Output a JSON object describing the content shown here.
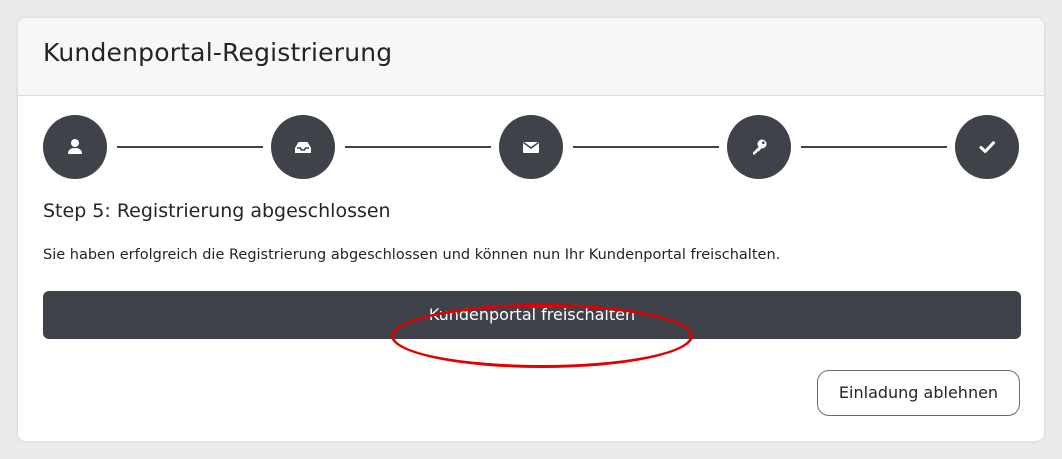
{
  "header": {
    "title": "Kundenportal-Registrierung"
  },
  "stepper": {
    "steps": [
      {
        "icon": "user-icon"
      },
      {
        "icon": "inbox-icon"
      },
      {
        "icon": "envelope-icon"
      },
      {
        "icon": "key-icon"
      },
      {
        "icon": "checkmark-icon"
      }
    ],
    "current_step": 5,
    "color": "#40424a"
  },
  "content": {
    "heading": "Step 5: Registrierung abgeschlossen",
    "text": "Sie haben erfolgreich die Registrierung abgeschlossen und können nun Ihr Kundenportal freischalten.",
    "primary_button": "Kundenportal freischalten",
    "secondary_button": "Einladung ablehnen"
  },
  "annotation": {
    "highlight_color": "#e00000"
  }
}
